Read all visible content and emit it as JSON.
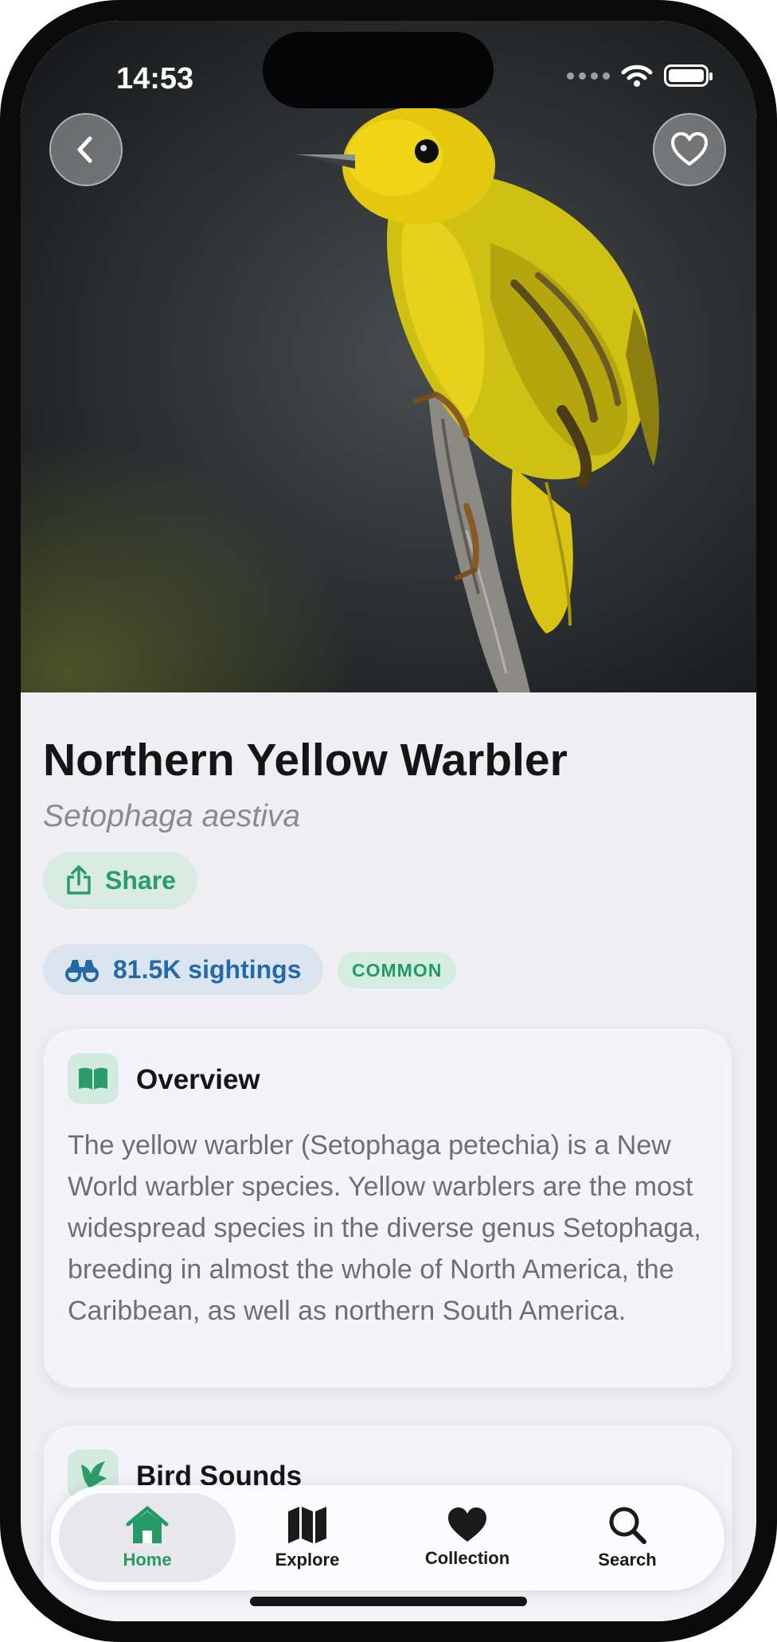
{
  "status_bar": {
    "time": "14:53"
  },
  "species": {
    "common_name": "Northern Yellow Warbler",
    "scientific_name": "Setophaga aestiva"
  },
  "actions": {
    "share_label": "Share"
  },
  "stats": {
    "sightings": "81.5K sightings",
    "abundance_badge": "COMMON"
  },
  "overview": {
    "title": "Overview",
    "body": "The yellow warbler (Setophaga petechia) is a New World warbler species. Yellow warblers are the most widespread species in the diverse genus Setophaga, breeding in almost the whole of North America, the Caribbean, as well as northern South America."
  },
  "sounds": {
    "title": "Bird Sounds"
  },
  "tabbar": {
    "items": [
      {
        "label": "Home",
        "icon": "house-icon"
      },
      {
        "label": "Explore",
        "icon": "map-icon"
      },
      {
        "label": "Collection",
        "icon": "heart-icon"
      },
      {
        "label": "Search",
        "icon": "magnifier-icon"
      }
    ],
    "active_index": 0
  },
  "colors": {
    "accent_green": "#259a66",
    "sightings_blue": "#246aa8",
    "background": "#efeef3"
  }
}
